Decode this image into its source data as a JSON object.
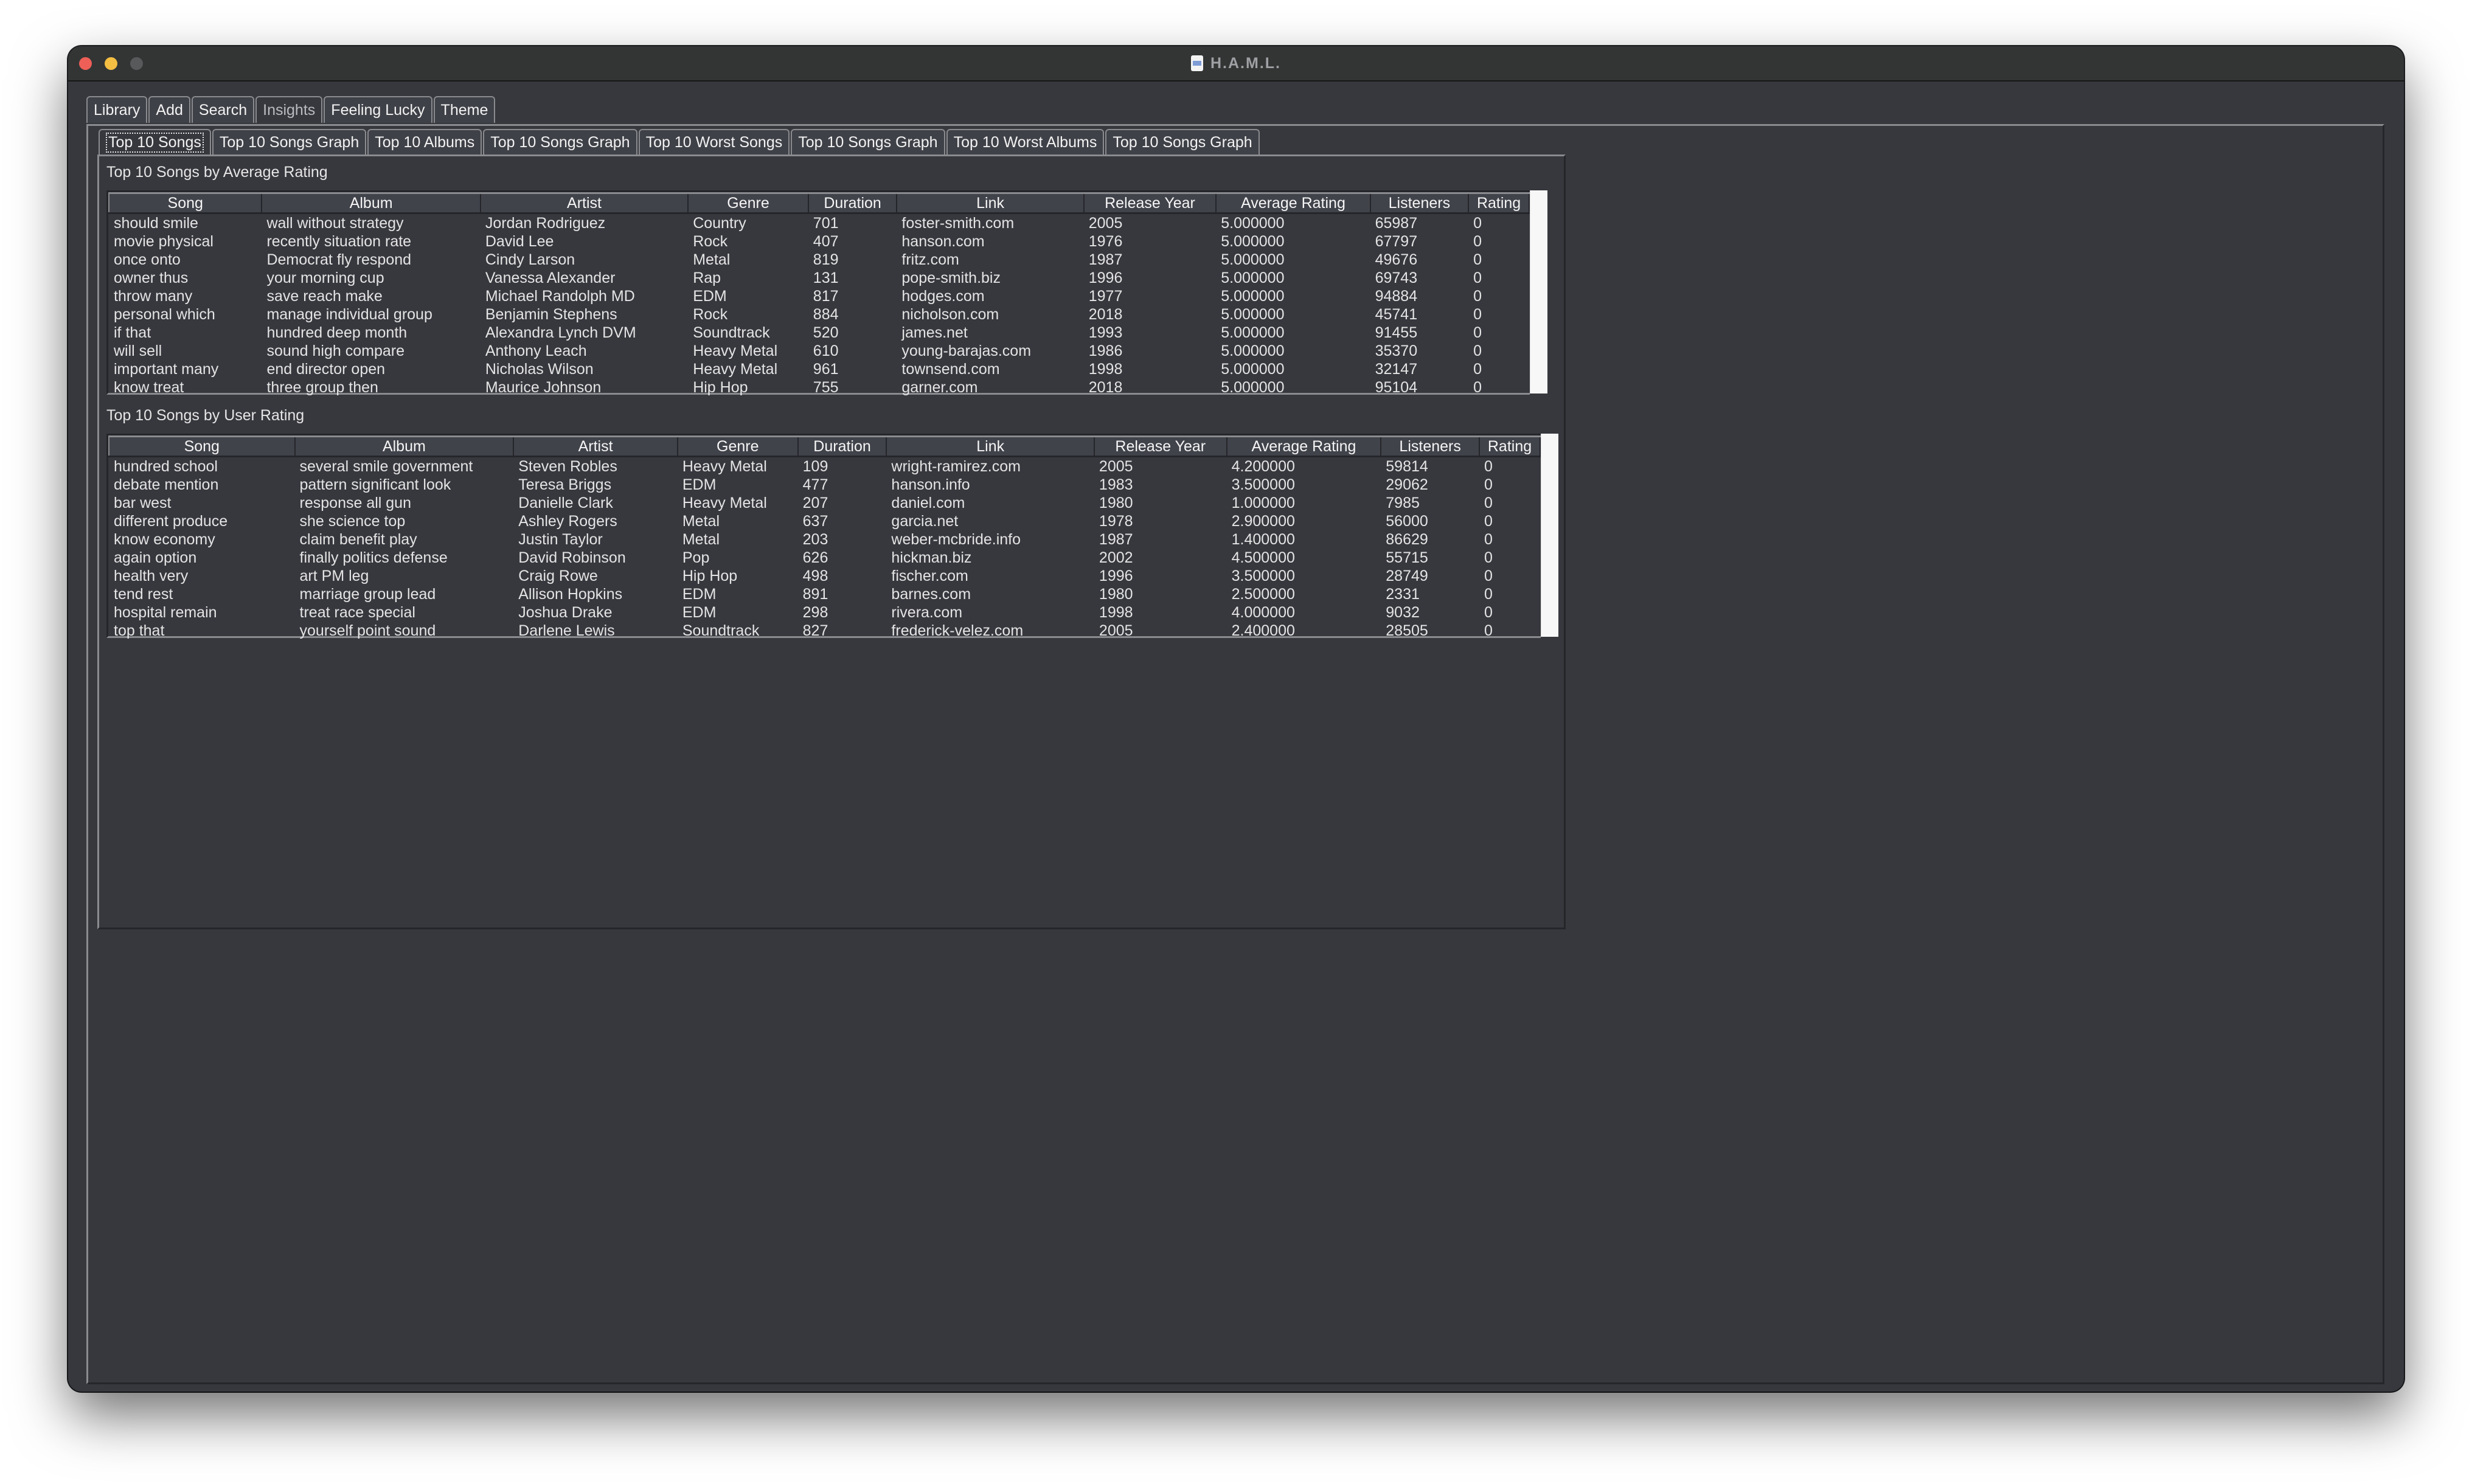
{
  "window": {
    "title": "H.A.M.L.",
    "title_icon": "document-icon"
  },
  "main_tabs": [
    {
      "label": "Library",
      "selected": false
    },
    {
      "label": "Add",
      "selected": false
    },
    {
      "label": "Search",
      "selected": false
    },
    {
      "label": "Insights",
      "selected": true
    },
    {
      "label": "Feeling Lucky",
      "selected": false
    },
    {
      "label": "Theme",
      "selected": false
    }
  ],
  "sub_tabs": [
    {
      "label": "Top 10 Songs",
      "selected": true
    },
    {
      "label": "Top 10 Songs Graph",
      "selected": false
    },
    {
      "label": "Top 10 Albums",
      "selected": false
    },
    {
      "label": "Top 10 Songs Graph",
      "selected": false
    },
    {
      "label": "Top 10 Worst Songs",
      "selected": false
    },
    {
      "label": "Top 10 Songs Graph",
      "selected": false
    },
    {
      "label": "Top 10 Worst Albums",
      "selected": false
    },
    {
      "label": "Top 10 Songs Graph",
      "selected": false
    }
  ],
  "columns": [
    "Song",
    "Album",
    "Artist",
    "Genre",
    "Duration",
    "Link",
    "Release Year",
    "Average Rating",
    "Listeners",
    "Rating"
  ],
  "avg_table": {
    "label": "Top 10 Songs by Average Rating",
    "rows": [
      [
        "should smile",
        "wall without strategy",
        "Jordan Rodriguez",
        "Country",
        "701",
        "foster-smith.com",
        "2005",
        "5.000000",
        "65987",
        "0"
      ],
      [
        "movie physical",
        "recently situation rate",
        "David Lee",
        "Rock",
        "407",
        "hanson.com",
        "1976",
        "5.000000",
        "67797",
        "0"
      ],
      [
        "once onto",
        "Democrat fly respond",
        "Cindy Larson",
        "Metal",
        "819",
        "fritz.com",
        "1987",
        "5.000000",
        "49676",
        "0"
      ],
      [
        "owner thus",
        "your morning cup",
        "Vanessa Alexander",
        "Rap",
        "131",
        "pope-smith.biz",
        "1996",
        "5.000000",
        "69743",
        "0"
      ],
      [
        "throw many",
        "save reach make",
        "Michael Randolph MD",
        "EDM",
        "817",
        "hodges.com",
        "1977",
        "5.000000",
        "94884",
        "0"
      ],
      [
        "personal which",
        "manage individual group",
        "Benjamin Stephens",
        "Rock",
        "884",
        "nicholson.com",
        "2018",
        "5.000000",
        "45741",
        "0"
      ],
      [
        "if that",
        "hundred deep month",
        "Alexandra Lynch DVM",
        "Soundtrack",
        "520",
        "james.net",
        "1993",
        "5.000000",
        "91455",
        "0"
      ],
      [
        "will sell",
        "sound high compare",
        "Anthony Leach",
        "Heavy Metal",
        "610",
        "young-barajas.com",
        "1986",
        "5.000000",
        "35370",
        "0"
      ],
      [
        "important many",
        "end director open",
        "Nicholas Wilson",
        "Heavy Metal",
        "961",
        "townsend.com",
        "1998",
        "5.000000",
        "32147",
        "0"
      ],
      [
        "know treat",
        "three group then",
        "Maurice Johnson",
        "Hip Hop",
        "755",
        "garner.com",
        "2018",
        "5.000000",
        "95104",
        "0"
      ]
    ]
  },
  "user_table": {
    "label": "Top 10 Songs by User Rating",
    "rows": [
      [
        "hundred school",
        "several smile government",
        "Steven Robles",
        "Heavy Metal",
        "109",
        "wright-ramirez.com",
        "2005",
        "4.200000",
        "59814",
        "0"
      ],
      [
        "debate mention",
        "pattern significant look",
        "Teresa Briggs",
        "EDM",
        "477",
        "hanson.info",
        "1983",
        "3.500000",
        "29062",
        "0"
      ],
      [
        "bar west",
        "response all gun",
        "Danielle Clark",
        "Heavy Metal",
        "207",
        "daniel.com",
        "1980",
        "1.000000",
        "7985",
        "0"
      ],
      [
        "different produce",
        "she science top",
        "Ashley Rogers",
        "Metal",
        "637",
        "garcia.net",
        "1978",
        "2.900000",
        "56000",
        "0"
      ],
      [
        "know economy",
        "claim benefit play",
        "Justin Taylor",
        "Metal",
        "203",
        "weber-mcbride.info",
        "1987",
        "1.400000",
        "86629",
        "0"
      ],
      [
        "again option",
        "finally politics defense",
        "David Robinson",
        "Pop",
        "626",
        "hickman.biz",
        "2002",
        "4.500000",
        "55715",
        "0"
      ],
      [
        "health very",
        "art PM leg",
        "Craig Rowe",
        "Hip Hop",
        "498",
        "fischer.com",
        "1996",
        "3.500000",
        "28749",
        "0"
      ],
      [
        "tend rest",
        "marriage group lead",
        "Allison Hopkins",
        "EDM",
        "891",
        "barnes.com",
        "1980",
        "2.500000",
        "2331",
        "0"
      ],
      [
        "hospital remain",
        "treat race special",
        "Joshua Drake",
        "EDM",
        "298",
        "rivera.com",
        "1998",
        "4.000000",
        "9032",
        "0"
      ],
      [
        "top that",
        "yourself point sound",
        "Darlene Lewis",
        "Soundtrack",
        "827",
        "frederick-velez.com",
        "2005",
        "2.400000",
        "28505",
        "0"
      ]
    ]
  }
}
